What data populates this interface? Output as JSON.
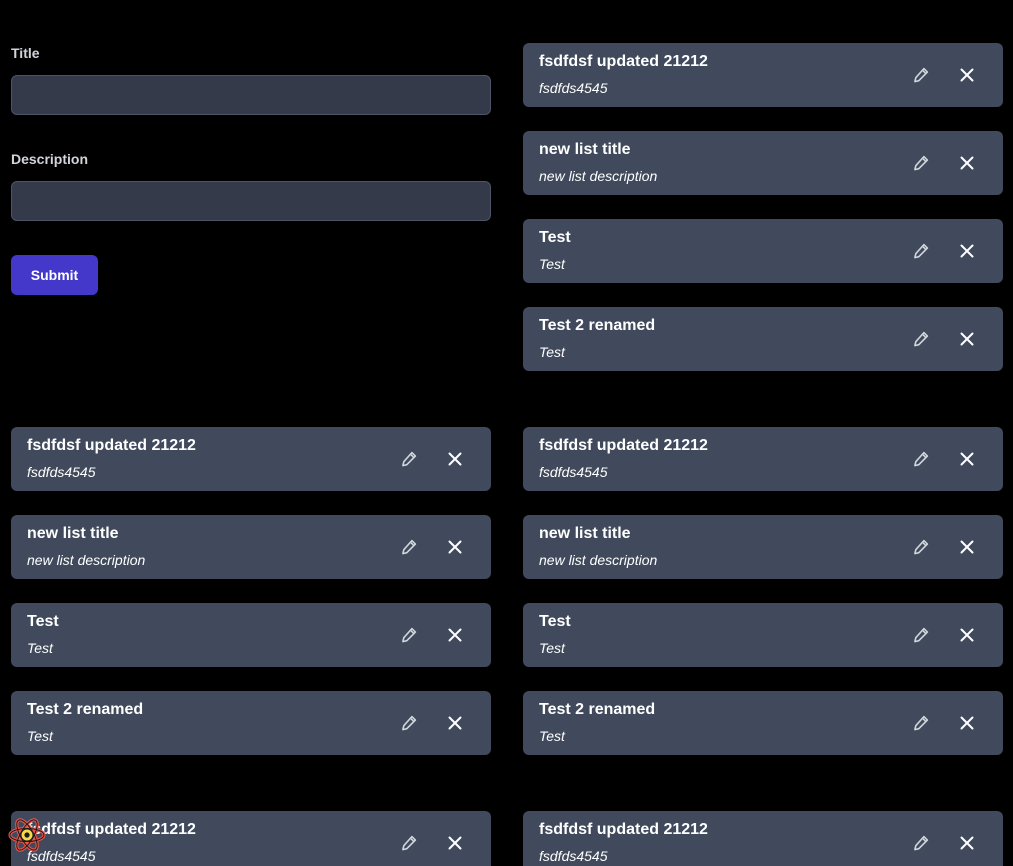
{
  "form": {
    "title_label": "Title",
    "title_value": "",
    "description_label": "Description",
    "description_value": "",
    "submit_label": "Submit"
  },
  "lists": [
    {
      "name": "list-top-right",
      "items": [
        {
          "title": "fsdfdsf updated 21212",
          "description": "fsdfds4545"
        },
        {
          "title": "new list title",
          "description": "new list description"
        },
        {
          "title": "Test",
          "description": "Test"
        },
        {
          "title": "Test 2 renamed",
          "description": "Test"
        }
      ]
    },
    {
      "name": "list-middle-left",
      "items": [
        {
          "title": "fsdfdsf updated 21212",
          "description": "fsdfds4545"
        },
        {
          "title": "new list title",
          "description": "new list description"
        },
        {
          "title": "Test",
          "description": "Test"
        },
        {
          "title": "Test 2 renamed",
          "description": "Test"
        }
      ]
    },
    {
      "name": "list-middle-right",
      "items": [
        {
          "title": "fsdfdsf updated 21212",
          "description": "fsdfds4545"
        },
        {
          "title": "new list title",
          "description": "new list description"
        },
        {
          "title": "Test",
          "description": "Test"
        },
        {
          "title": "Test 2 renamed",
          "description": "Test"
        }
      ]
    },
    {
      "name": "list-bottom-left",
      "items": [
        {
          "title": "fsdfdsf updated 21212",
          "description": "fsdfds4545"
        }
      ]
    },
    {
      "name": "list-bottom-right",
      "items": [
        {
          "title": "fsdfdsf updated 21212",
          "description": "fsdfds4545"
        }
      ]
    }
  ],
  "icons": {
    "edit": "pencil-icon",
    "delete": "close-icon",
    "devtools": "react-devtools-logo-icon"
  },
  "colors": {
    "background": "#000000",
    "card": "#404a5c",
    "input": "#343a4a",
    "submit": "#4338ca"
  }
}
